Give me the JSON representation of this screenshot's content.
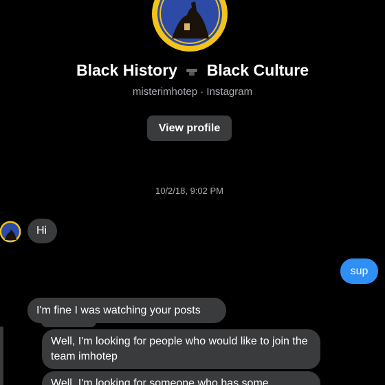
{
  "profile": {
    "avatar_icon": "profile-avatar-icon",
    "title_part1": "Black History",
    "title_part2": "Black Culture",
    "title_icon": "fist-emoji-icon",
    "subtitle": "misterimhotep · Instagram",
    "view_profile_label": "View profile"
  },
  "conversation": {
    "timestamp": "10/2/18, 9:02 PM",
    "messages": [
      {
        "from": "them",
        "text": "Hi"
      },
      {
        "from": "me",
        "text": "sup"
      },
      {
        "from": "them",
        "text": "I'm fine I was watching your posts"
      },
      {
        "from": "them_reply",
        "text": "Well, I'm looking for people who would like to join the team imhotep"
      },
      {
        "from": "them_reply",
        "text": "Well, I'm looking for someone who has some"
      }
    ]
  },
  "colors": {
    "background": "#000000",
    "incoming_bubble": "#3a3b3c",
    "outgoing_bubble": "#2f8ff5",
    "secondary_text": "#a8abb0",
    "avatar_ring": "#f2c31a",
    "avatar_inner": "#2c4aa6"
  }
}
